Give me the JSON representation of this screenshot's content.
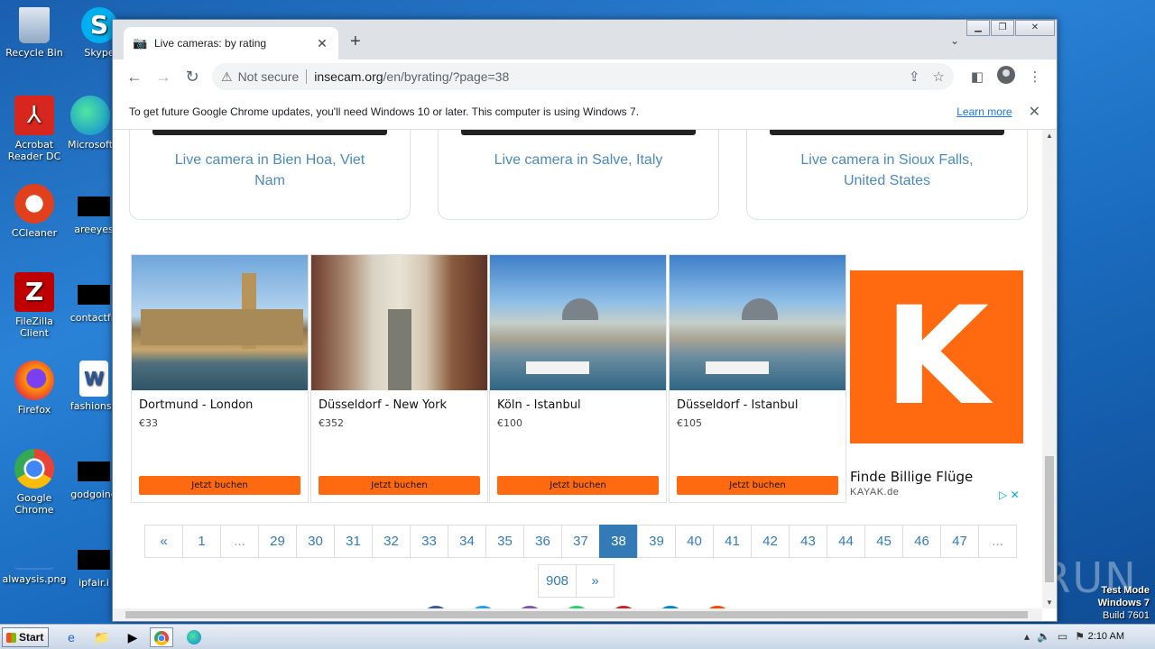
{
  "desktop": {
    "icons": [
      {
        "label": "Recycle Bin"
      },
      {
        "label": "Skype"
      },
      {
        "label": "Acrobat Reader DC"
      },
      {
        "label": "Microsoft"
      },
      {
        "label": "CCleaner"
      },
      {
        "label": "areeyes"
      },
      {
        "label": "FileZilla Client"
      },
      {
        "label": "contactfri"
      },
      {
        "label": "Firefox"
      },
      {
        "label": "fashionsy"
      },
      {
        "label": "Google Chrome"
      },
      {
        "label": "godgoing"
      },
      {
        "label": "alwaysis.png"
      },
      {
        "label": "ipfair.i"
      }
    ],
    "watermark": "ANY RUN",
    "test_mode": {
      "line1": "Test Mode",
      "line2": "Windows 7",
      "line3": "Build 7601"
    }
  },
  "browser": {
    "tab_title": "Live cameras: by rating",
    "new_tab": "+",
    "address": {
      "security": "Not secure",
      "host": "insecam.org",
      "path": "/en/byrating/?page=38"
    },
    "infobar": {
      "message": "To get future Google Chrome updates, you'll need Windows 10 or later. This computer is using Windows 7.",
      "link": "Learn more"
    }
  },
  "cameras": [
    {
      "label": "Live camera in Bien Hoa, Viet Nam"
    },
    {
      "label": "Live camera in Salve, Italy"
    },
    {
      "label": "Live camera in Sioux Falls, United States"
    }
  ],
  "ad": {
    "offers": [
      {
        "route": "Dortmund - London",
        "price": "€33",
        "button": "Jetzt buchen"
      },
      {
        "route": "Düsseldorf - New York",
        "price": "€352",
        "button": "Jetzt buchen"
      },
      {
        "route": "Köln - Istanbul",
        "price": "€100",
        "button": "Jetzt buchen"
      },
      {
        "route": "Düsseldorf - Istanbul",
        "price": "€105",
        "button": "Jetzt buchen"
      }
    ],
    "logo_letter": "K",
    "headline": "Finde Billige Flüge",
    "brand": "KAYAK.de",
    "colors": {
      "brand": "#ff690f"
    }
  },
  "pagination": {
    "prev": "«",
    "pages": [
      "1",
      "...",
      "29",
      "30",
      "31",
      "32",
      "33",
      "34",
      "35",
      "36",
      "37",
      "38",
      "39",
      "40",
      "41",
      "42",
      "43",
      "44",
      "45",
      "46",
      "47",
      "..."
    ],
    "current": "38",
    "last": "908",
    "next": "»"
  },
  "taskbar": {
    "start": "Start",
    "time": "2:10 AM"
  }
}
